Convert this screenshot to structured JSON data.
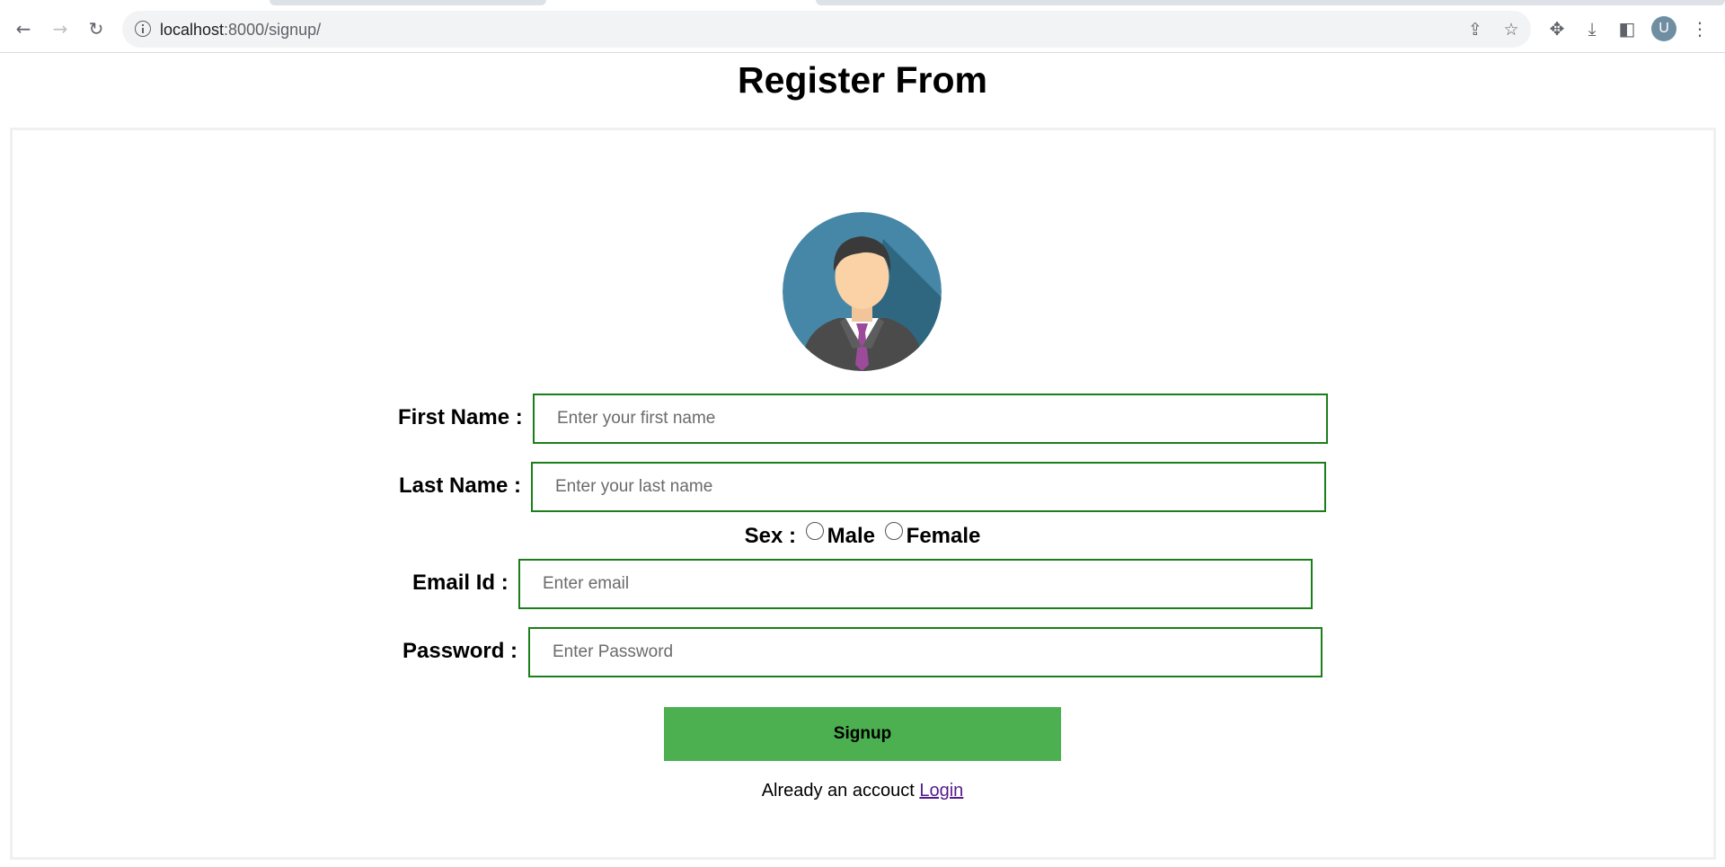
{
  "browser": {
    "url_host": "localhost",
    "url_rest": ":8000/signup/",
    "profile_initial": "U",
    "icons": [
      "back-icon",
      "forward-icon",
      "reload-icon",
      "info-icon",
      "share-icon",
      "star-icon",
      "extensions-icon",
      "download-icon",
      "side-panel-icon",
      "menu-icon"
    ]
  },
  "page": {
    "title": "Register From"
  },
  "form": {
    "first_name_label": "First Name :",
    "first_name_placeholder": "Enter your first name",
    "last_name_label": "Last Name :",
    "last_name_placeholder": "Enter your last name",
    "sex_label": "Sex :",
    "male_label": "Male",
    "female_label": "Female",
    "email_label": "Email Id :",
    "email_placeholder": "Enter email",
    "password_label": "Password :",
    "password_placeholder": "Enter Password",
    "signup_label": "Signup",
    "already_text": "Already an accouct",
    "login_link": "Login"
  },
  "colors": {
    "field_border": "#1a7f1a",
    "button_bg": "#4caf50",
    "link": "#551a8b"
  }
}
